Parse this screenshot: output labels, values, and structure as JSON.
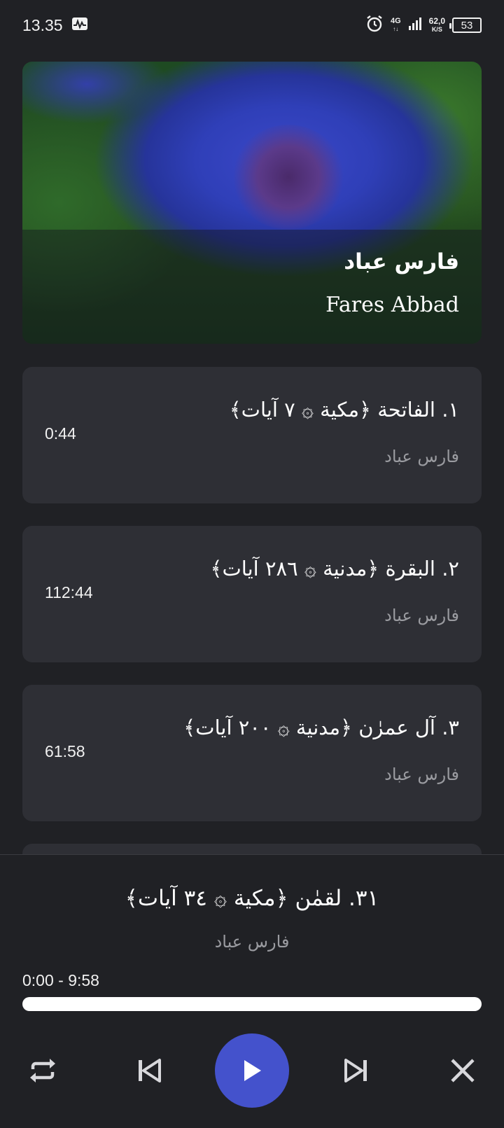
{
  "status_bar": {
    "time": "13.35",
    "network_type": "4G",
    "network_speed": "62,0",
    "network_speed_unit": "K/S",
    "battery": "53"
  },
  "header": {
    "reciter_name_ar": "فارس عباد",
    "reciter_name_en": "Fares Abbad"
  },
  "tracks": [
    {
      "title": "١. الفاتحة ﴿مكية ۞ ٧ آيات﴾",
      "artist": "فارس عباد",
      "duration": "0:44"
    },
    {
      "title": "٢. البقرة ﴿مدنية ۞ ٢٨٦ آيات﴾",
      "artist": "فارس عباد",
      "duration": "112:44"
    },
    {
      "title": "٣. آل عمرٰن ﴿مدنية ۞ ٢٠٠ آيات﴾",
      "artist": "فارس عباد",
      "duration": "61:58"
    }
  ],
  "player": {
    "now_playing_title": "٣١. لقمٰن ﴿مكية ۞ ٣٤ آيات﴾",
    "now_playing_artist": "فارس عباد",
    "time": "0:00 - 9:58",
    "progress": 0,
    "accent_color": "#4452cc",
    "controls": {
      "repeat_icon": "repeat-icon",
      "previous_icon": "skip-previous-icon",
      "play_icon": "play-icon",
      "next_icon": "skip-next-icon",
      "close_icon": "close-icon"
    }
  }
}
